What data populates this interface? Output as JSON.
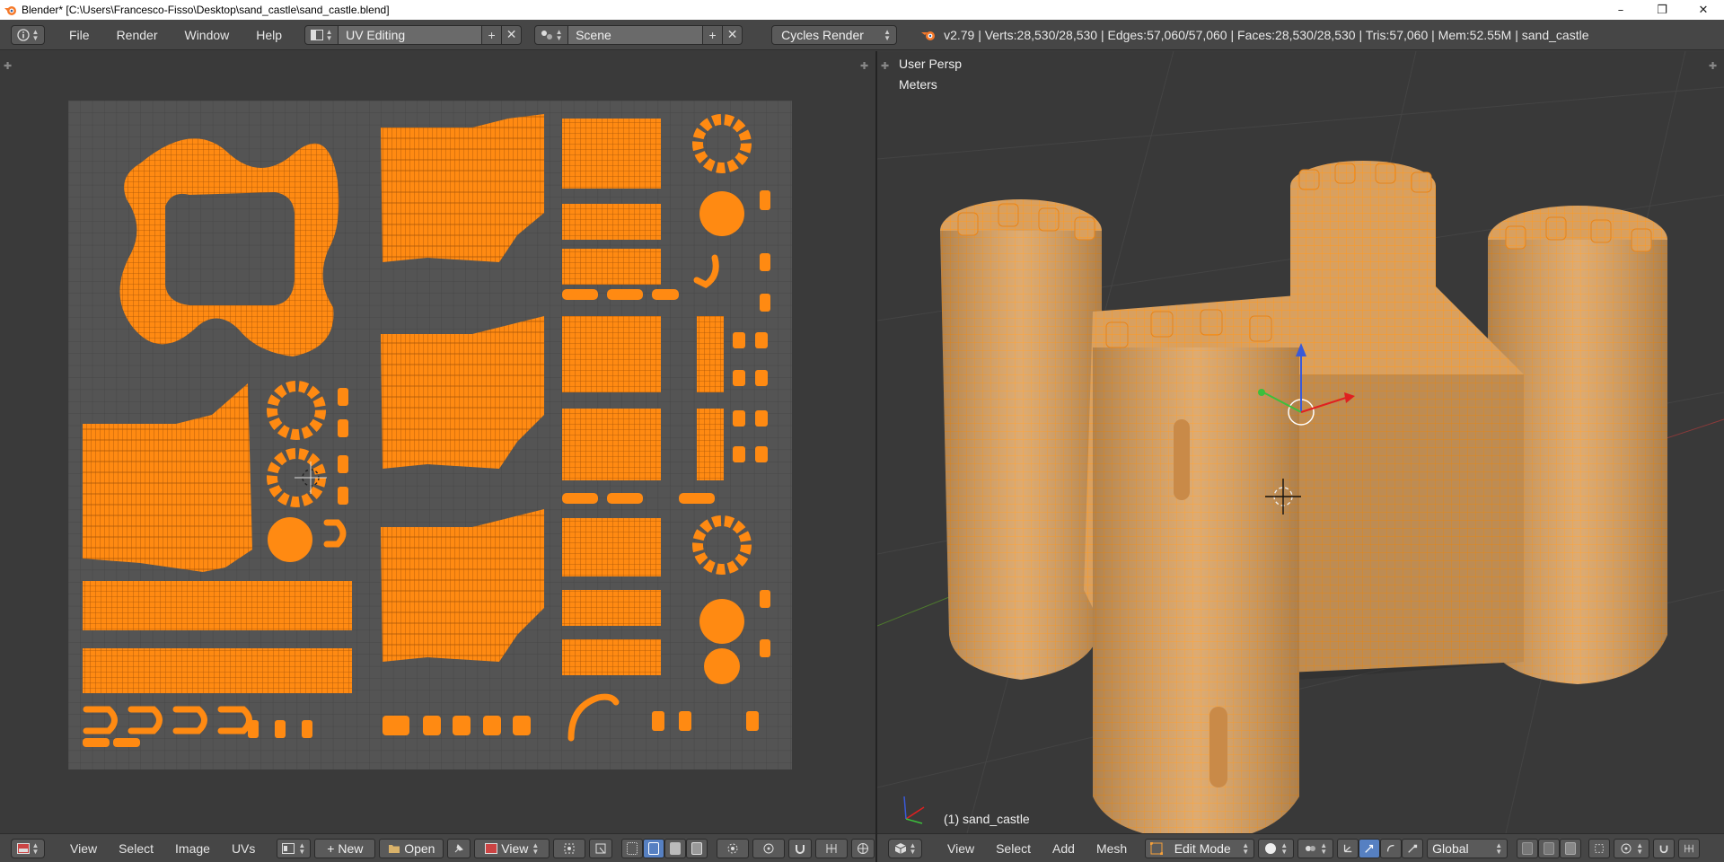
{
  "window": {
    "title": "Blender* [C:\\Users\\Francesco-Fisso\\Desktop\\sand_castle\\sand_castle.blend]",
    "controls": [
      "–",
      "❐",
      "✕"
    ]
  },
  "info_header": {
    "menus": [
      "File",
      "Render",
      "Window",
      "Help"
    ],
    "screen_layout": "UV Editing",
    "scene": "Scene",
    "render_engine": "Cycles Render",
    "stats": "v2.79 | Verts:28,530/28,530 | Edges:57,060/57,060 | Faces:28,530/28,530 | Tris:57,060 | Mem:52.55M | sand_castle"
  },
  "viewport": {
    "view_name": "User Persp",
    "units": "Meters",
    "object_label": "(1) sand_castle"
  },
  "uv_header": {
    "menus": [
      "View",
      "Select",
      "Image",
      "UVs"
    ],
    "new_label": "New",
    "open_label": "Open",
    "view_label": "View"
  },
  "view3d_header": {
    "menus": [
      "View",
      "Select",
      "Add",
      "Mesh"
    ],
    "mode": "Edit Mode",
    "orientation": "Global"
  },
  "colors": {
    "accent": "#ff8a12",
    "panel": "#464646",
    "uv_grid": "#555555",
    "selection_blue": "#5680c2"
  }
}
